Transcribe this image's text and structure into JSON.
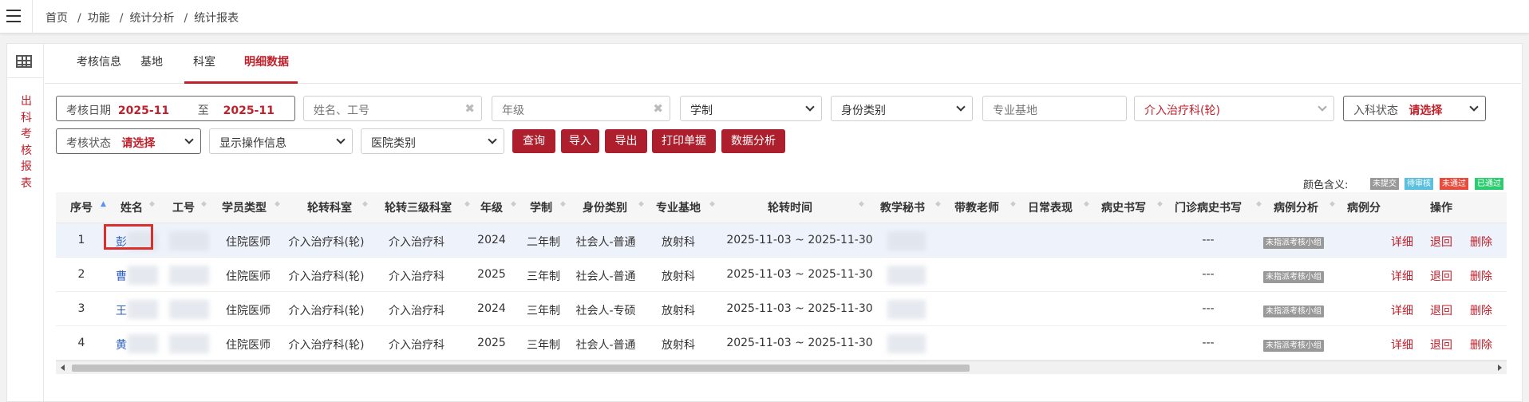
{
  "breadcrumb": [
    "首页",
    "功能",
    "统计分析",
    "统计报表"
  ],
  "sidebar": {
    "label": "出科考核报表"
  },
  "tabs": [
    "考核信息",
    "基地",
    "科室",
    "明细数据"
  ],
  "filters": {
    "date_label": "考核日期",
    "date_from": "2025-11",
    "date_sep": "至",
    "date_to": "2025-11",
    "name_placeholder": "姓名、工号",
    "grade_placeholder": "年级",
    "system_select": "学制",
    "identity_select": "身份类别",
    "base_placeholder": "专业基地",
    "dept_select": "介入治疗科(轮)",
    "entry_status_label": "入科状态",
    "entry_status_value": "请选择",
    "exam_status_label": "考核状态",
    "exam_status_value": "请选择",
    "show_ops_select": "显示操作信息",
    "hospital_select": "医院类别"
  },
  "buttons": [
    "查询",
    "导入",
    "导出",
    "打印单据",
    "数据分析"
  ],
  "legend": {
    "label": "颜色含义:",
    "items": [
      {
        "text": "未提交",
        "color": "#999999"
      },
      {
        "text": "待审核",
        "color": "#5bc0de"
      },
      {
        "text": "未通过",
        "color": "#e74c3c"
      },
      {
        "text": "已通过",
        "color": "#2ecc71"
      }
    ]
  },
  "columns": [
    "序号",
    "姓名",
    "工号",
    "学员类型",
    "轮转科室",
    "轮转三级科室",
    "年级",
    "学制",
    "身份类别",
    "专业基地",
    "轮转时间",
    "教学秘书",
    "带教老师",
    "日常表现",
    "病史书写",
    "门诊病史书写",
    "病例分析",
    "病例分",
    "操作"
  ],
  "rows": [
    {
      "no": "1",
      "name": "彭",
      "type": "住院医师",
      "dept": "介入治疗科(轮)",
      "sub_dept": "介入治疗科",
      "grade": "2024",
      "system": "二年制",
      "identity": "社会人-普通",
      "base": "放射科",
      "period": "2025-11-03 ~ 2025-11-30",
      "outpatient": "---",
      "badge": "未指派考核小组"
    },
    {
      "no": "2",
      "name": "曹",
      "type": "住院医师",
      "dept": "介入治疗科(轮)",
      "sub_dept": "介入治疗科",
      "grade": "2025",
      "system": "三年制",
      "identity": "社会人-普通",
      "base": "放射科",
      "period": "2025-11-03 ~ 2025-11-30",
      "outpatient": "---",
      "badge": "未指派考核小组"
    },
    {
      "no": "3",
      "name": "王",
      "type": "住院医师",
      "dept": "介入治疗科(轮)",
      "sub_dept": "介入治疗科",
      "grade": "2024",
      "system": "三年制",
      "identity": "社会人-专硕",
      "base": "放射科",
      "period": "2025-11-03 ~ 2025-11-30",
      "outpatient": "---",
      "badge": "未指派考核小组"
    },
    {
      "no": "4",
      "name": "黄",
      "type": "住院医师",
      "dept": "介入治疗科(轮)",
      "sub_dept": "介入治疗科",
      "grade": "2025",
      "system": "三年制",
      "identity": "社会人-普通",
      "base": "放射科",
      "period": "2025-11-03 ~ 2025-11-30",
      "outpatient": "---",
      "badge": "未指派考核小组"
    }
  ],
  "row_actions": [
    "详细",
    "退回",
    "删除"
  ]
}
